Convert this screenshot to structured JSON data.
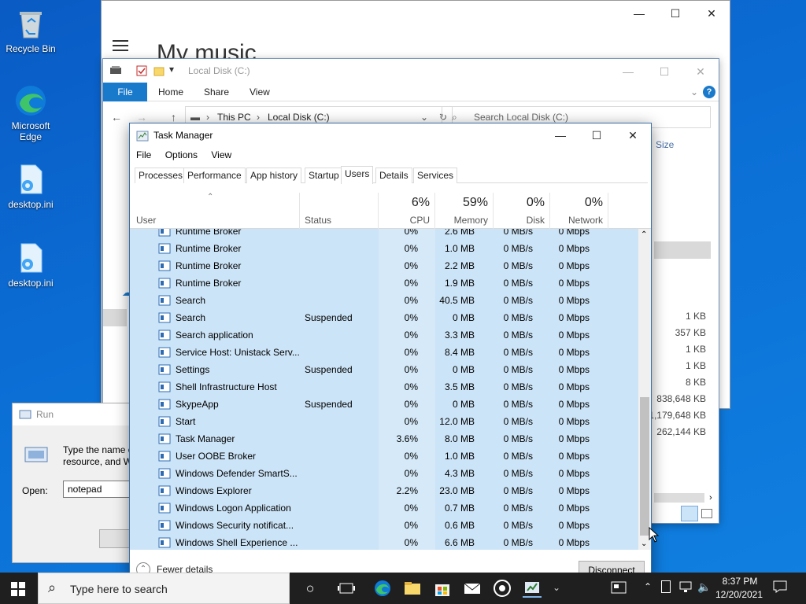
{
  "desktop": {
    "icons": [
      {
        "label": "Recycle Bin"
      },
      {
        "label": "Microsoft Edge"
      },
      {
        "label": "desktop.ini"
      },
      {
        "label": "desktop.ini"
      }
    ]
  },
  "music_window": {
    "title": "My music"
  },
  "explorer": {
    "title": "Local Disk (C:)",
    "ribbon_tabs": [
      "File",
      "Home",
      "Share",
      "View"
    ],
    "breadcrumb": [
      "This PC",
      "Local Disk (C:)"
    ],
    "search_placeholder": "Search Local Disk (C:)",
    "size_header": "Size",
    "sizes": [
      "1 KB",
      "357 KB",
      "1 KB",
      "1 KB",
      "8 KB",
      "838,648 KB",
      "1,179,648 KB",
      "262,144 KB"
    ]
  },
  "run_dialog": {
    "title": "Run",
    "desc_line1": "Type the name o",
    "desc_line2": "resource, and W",
    "open_label": "Open:",
    "open_value": "notepad"
  },
  "task_manager": {
    "title": "Task Manager",
    "menu": [
      "File",
      "Options",
      "View"
    ],
    "tabs": [
      "Processes",
      "Performance",
      "App history",
      "Startup",
      "Users",
      "Details",
      "Services"
    ],
    "active_tab": "Users",
    "columns": {
      "user": "User",
      "status": "Status",
      "cpu_pct": "6%",
      "cpu": "CPU",
      "mem_pct": "59%",
      "mem": "Memory",
      "disk_pct": "0%",
      "disk": "Disk",
      "net_pct": "0%",
      "net": "Network"
    },
    "rows": [
      {
        "name": "Runtime Broker",
        "status": "",
        "cpu": "0%",
        "mem": "2.6 MB",
        "disk": "0 MB/s",
        "net": "0 Mbps",
        "icon": "app-frame-icon"
      },
      {
        "name": "Runtime Broker",
        "status": "",
        "cpu": "0%",
        "mem": "1.0 MB",
        "disk": "0 MB/s",
        "net": "0 Mbps",
        "icon": "app-frame-icon"
      },
      {
        "name": "Runtime Broker",
        "status": "",
        "cpu": "0%",
        "mem": "2.2 MB",
        "disk": "0 MB/s",
        "net": "0 Mbps",
        "icon": "app-frame-icon"
      },
      {
        "name": "Runtime Broker",
        "status": "",
        "cpu": "0%",
        "mem": "1.9 MB",
        "disk": "0 MB/s",
        "net": "0 Mbps",
        "icon": "app-frame-icon"
      },
      {
        "name": "Search",
        "status": "",
        "cpu": "0%",
        "mem": "40.5 MB",
        "disk": "0 MB/s",
        "net": "0 Mbps",
        "icon": "search-icon"
      },
      {
        "name": "Search",
        "status": "Suspended",
        "cpu": "0%",
        "mem": "0 MB",
        "disk": "0 MB/s",
        "net": "0 Mbps",
        "icon": "search-icon"
      },
      {
        "name": "Search application",
        "status": "",
        "cpu": "0%",
        "mem": "3.3 MB",
        "disk": "0 MB/s",
        "net": "0 Mbps",
        "icon": "search-icon"
      },
      {
        "name": "Service Host: Unistack Serv...",
        "status": "",
        "cpu": "0%",
        "mem": "8.4 MB",
        "disk": "0 MB/s",
        "net": "0 Mbps",
        "icon": "gear-icon"
      },
      {
        "name": "Settings",
        "status": "Suspended",
        "cpu": "0%",
        "mem": "0 MB",
        "disk": "0 MB/s",
        "net": "0 Mbps",
        "icon": "settings-icon"
      },
      {
        "name": "Shell Infrastructure Host",
        "status": "",
        "cpu": "0%",
        "mem": "3.5 MB",
        "disk": "0 MB/s",
        "net": "0 Mbps",
        "icon": "app-frame-icon"
      },
      {
        "name": "SkypeApp",
        "status": "Suspended",
        "cpu": "0%",
        "mem": "0 MB",
        "disk": "0 MB/s",
        "net": "0 Mbps",
        "icon": "skype-icon"
      },
      {
        "name": "Start",
        "status": "",
        "cpu": "0%",
        "mem": "12.0 MB",
        "disk": "0 MB/s",
        "net": "0 Mbps",
        "icon": "window-icon"
      },
      {
        "name": "Task Manager",
        "status": "",
        "cpu": "3.6%",
        "mem": "8.0 MB",
        "disk": "0 MB/s",
        "net": "0 Mbps",
        "icon": "task-manager-icon"
      },
      {
        "name": "User OOBE Broker",
        "status": "",
        "cpu": "0%",
        "mem": "1.0 MB",
        "disk": "0 MB/s",
        "net": "0 Mbps",
        "icon": "app-frame-icon"
      },
      {
        "name": "Windows Defender SmartS...",
        "status": "",
        "cpu": "0%",
        "mem": "4.3 MB",
        "disk": "0 MB/s",
        "net": "0 Mbps",
        "icon": "app-frame-icon"
      },
      {
        "name": "Windows Explorer",
        "status": "",
        "cpu": "2.2%",
        "mem": "23.0 MB",
        "disk": "0 MB/s",
        "net": "0 Mbps",
        "icon": "folder-icon"
      },
      {
        "name": "Windows Logon Application",
        "status": "",
        "cpu": "0%",
        "mem": "0.7 MB",
        "disk": "0 MB/s",
        "net": "0 Mbps",
        "icon": "app-frame-icon"
      },
      {
        "name": "Windows Security notificat...",
        "status": "",
        "cpu": "0%",
        "mem": "0.6 MB",
        "disk": "0 MB/s",
        "net": "0 Mbps",
        "icon": "shield-icon"
      },
      {
        "name": "Windows Shell Experience ...",
        "status": "",
        "cpu": "0%",
        "mem": "6.6 MB",
        "disk": "0 MB/s",
        "net": "0 Mbps",
        "icon": "window-icon"
      }
    ],
    "fewer_details": "Fewer details",
    "disconnect": "Disconnect"
  },
  "taskbar": {
    "search_placeholder": "Type here to search",
    "time": "8:37 PM",
    "date": "12/20/2021"
  },
  "colors": {
    "accent": "#1979ca",
    "row_highlight": "#cce4f7",
    "taskbar": "#1f1f1f"
  }
}
